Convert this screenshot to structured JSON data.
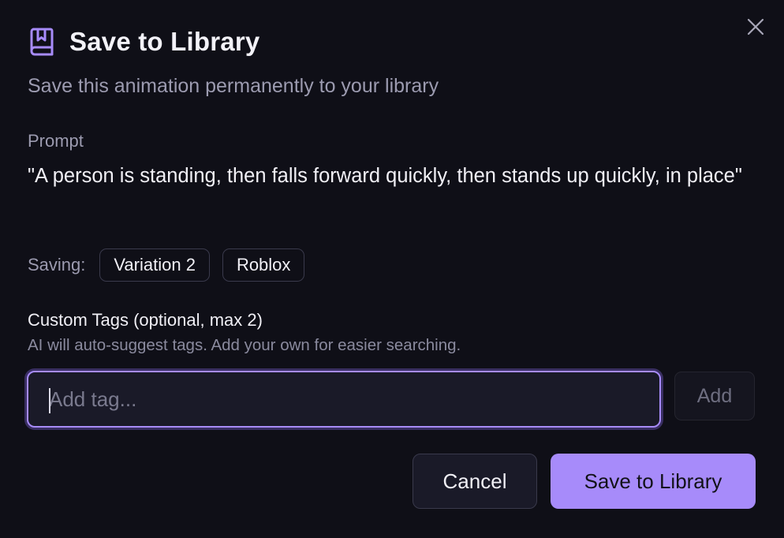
{
  "dialog": {
    "title": "Save to Library",
    "subtitle": "Save this animation permanently to your library",
    "close_icon": "close-icon",
    "title_icon": "bookmark-book-icon"
  },
  "prompt": {
    "label": "Prompt",
    "text": "\"A person is standing, then falls forward quickly, then stands up quickly, in place\""
  },
  "saving": {
    "label": "Saving:",
    "chips": [
      "Variation 2",
      "Roblox"
    ]
  },
  "tags": {
    "label": "Custom Tags (optional, max 2)",
    "help": "AI will auto-suggest tags. Add your own for easier searching.",
    "input_value": "",
    "input_placeholder": "Add tag...",
    "add_label": "Add"
  },
  "actions": {
    "cancel_label": "Cancel",
    "save_label": "Save to Library"
  },
  "colors": {
    "background": "#0f0f17",
    "accent": "#a78bfa",
    "muted_text": "#9c9bb0"
  }
}
